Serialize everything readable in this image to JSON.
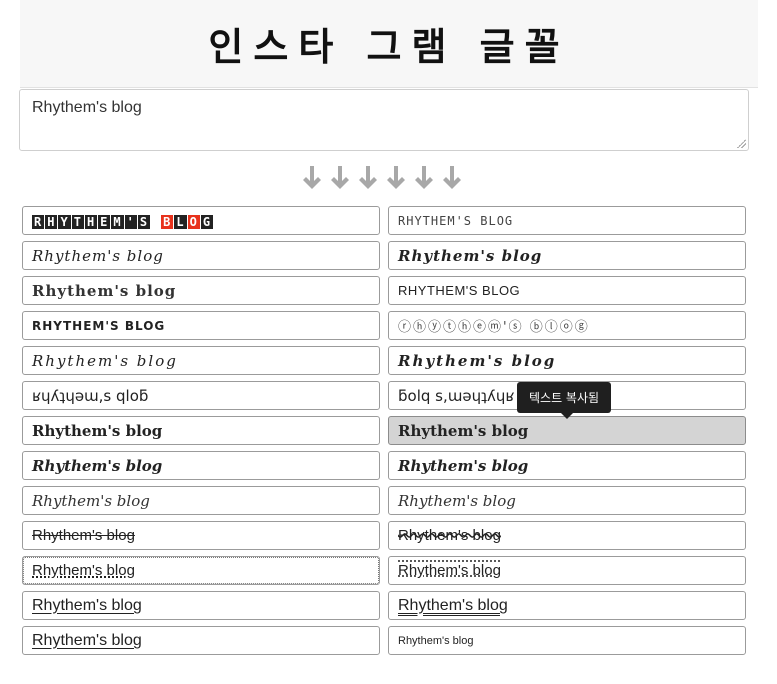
{
  "header": {
    "title": "인스타 그램 글꼴"
  },
  "input": {
    "value": "Rhythem's blog"
  },
  "arrows": {
    "count": 6,
    "color": "#a8a8a8"
  },
  "styles": [
    {
      "id": "box-colored",
      "text": "RHYTHEM'S BLOG"
    },
    {
      "id": "box-outline",
      "text": "RHYTHEM'S BLOG"
    },
    {
      "id": "fraktur",
      "text": "Rhythem's blog"
    },
    {
      "id": "fraktur-bold",
      "text": "Rhythem's blog"
    },
    {
      "id": "double-struck",
      "text": "Rhythem's blog"
    },
    {
      "id": "small-caps",
      "text": "RHYTHEM'S BLOG"
    },
    {
      "id": "circled-black",
      "text": "RHYTHEM'S BLOG"
    },
    {
      "id": "circled",
      "text": "ⓡⓗⓨⓣⓗⓔⓜ'ⓢ ⓑⓛⓞⓖ"
    },
    {
      "id": "script",
      "text": "Rhythem's blog"
    },
    {
      "id": "script-bold",
      "text": "Rhythem's blog"
    },
    {
      "id": "upside-down",
      "text": "ʁɥʎʇɥǝɯ,s qloƃ"
    },
    {
      "id": "upside-down-reversed",
      "text": "ƃolq s,ɯǝɥʇʎɥʁ"
    },
    {
      "id": "serif-bold",
      "text": "Rhythem's blog"
    },
    {
      "id": "serif-bold-hover",
      "text": "Rhythem's blog"
    },
    {
      "id": "serif-bold-italic",
      "text": "Rhythem's blog"
    },
    {
      "id": "serif-bold-italic-2",
      "text": "Rhythem's blog"
    },
    {
      "id": "serif-italic",
      "text": "Rhythem's blog"
    },
    {
      "id": "serif-italic-2",
      "text": "Rhythem's blog"
    },
    {
      "id": "strikethrough",
      "text": "Rhythem's blog"
    },
    {
      "id": "slash-through",
      "text": "Rhythem's blog"
    },
    {
      "id": "dotted",
      "text": "Rhythem's blog"
    },
    {
      "id": "noise",
      "text": "Rhythem's blog"
    },
    {
      "id": "underline",
      "text": "Rhythem's blog"
    },
    {
      "id": "double-underline",
      "text": "Rhythem's blog"
    },
    {
      "id": "underline-2",
      "text": "Rhythem's blog"
    },
    {
      "id": "small",
      "text": "Rhythem's blog"
    }
  ],
  "box_colors": {
    "dark": "#222222",
    "accent": "#e8321c"
  },
  "tooltip": {
    "text": "텍스트 복사됨"
  }
}
